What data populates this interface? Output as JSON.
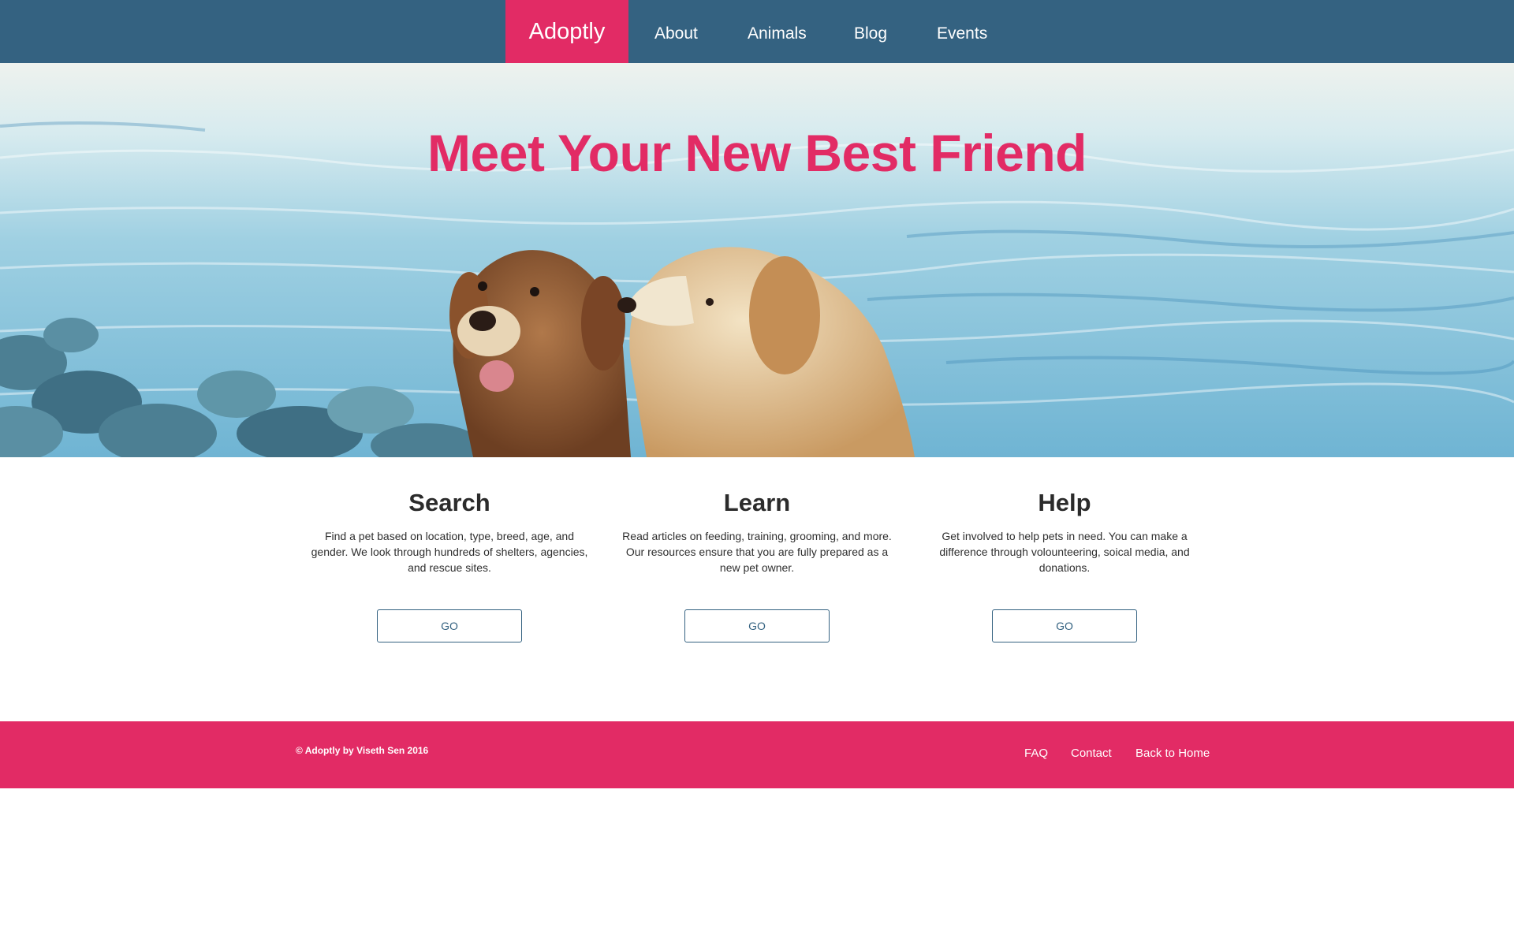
{
  "nav": {
    "brand": "Adoptly",
    "links": [
      "About",
      "Animals",
      "Blog",
      "Events"
    ]
  },
  "hero": {
    "title": "Meet Your New Best Friend"
  },
  "features": [
    {
      "title": "Search",
      "text": "Find a pet based on location, type, breed, age, and gender. We look through hundreds of shelters, agencies, and rescue sites.",
      "button": "GO"
    },
    {
      "title": "Learn",
      "text": "Read articles on feeding, training, grooming, and more. Our resources ensure that you are fully prepared as a new pet owner.",
      "button": "GO"
    },
    {
      "title": "Help",
      "text": "Get involved to help pets in need. You can make a difference through volounteering, soical media, and donations.",
      "button": "GO"
    }
  ],
  "footer": {
    "copyright": "© Adoptly by Viseth Sen 2016",
    "links": [
      "FAQ",
      "Contact",
      "Back to Home"
    ]
  },
  "colors": {
    "navbar": "#346281",
    "accent": "#e22b65",
    "button_border": "#346281",
    "text_dark": "#2b2b2b"
  }
}
